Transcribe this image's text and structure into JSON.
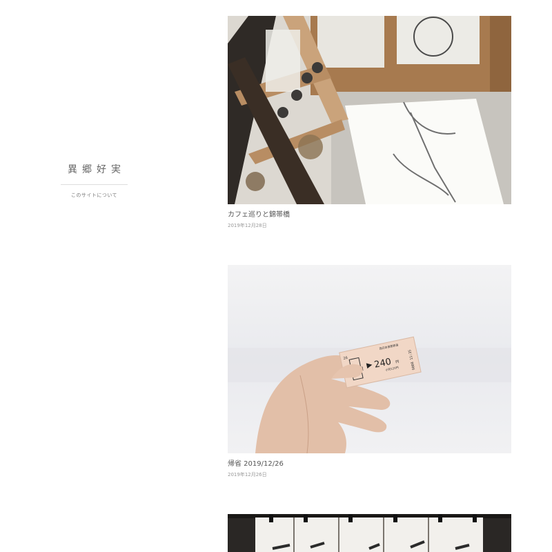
{
  "site": {
    "title": "異郷好実",
    "about_label": "このサイトについて"
  },
  "posts": [
    {
      "title": "カフェ巡りと錦帯橋",
      "date": "2019年12月28日",
      "photo_icon": "cafe-shelf-photo"
    },
    {
      "title": "帰省 2019/12/26",
      "date": "2019年12月26日",
      "photo_icon": "train-ticket-photo"
    },
    {
      "photo_icon": "noren-curtain-photo"
    }
  ],
  "ticket": {
    "station": "新山口",
    "fare": "240",
    "fare_unit": "円",
    "company": "西日本旅客鉄道",
    "date": "26",
    "number": "9008 11:35",
    "half_fare": "小児120円"
  },
  "colors": {
    "background": "#ffffff",
    "text": "#555555",
    "date_text": "#999999"
  }
}
